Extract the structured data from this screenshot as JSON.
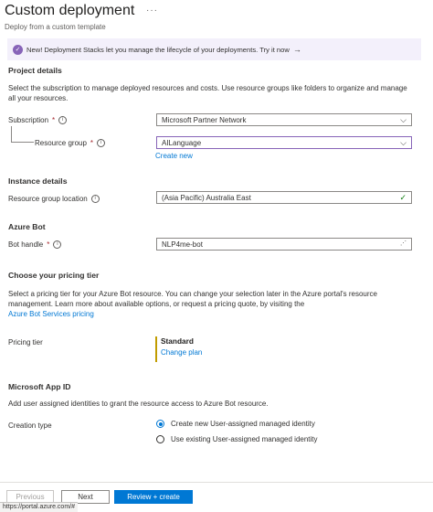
{
  "page": {
    "title": "Custom deployment",
    "more": "···",
    "subtitle": "Deploy from a custom template"
  },
  "banner": {
    "icon": "rocket-badge-icon",
    "text": "New! Deployment Stacks let you manage the lifecycle of your deployments. Try it now",
    "arrow": "→"
  },
  "project": {
    "heading": "Project details",
    "description": "Select the subscription to manage deployed resources and costs. Use resource groups like folders to organize and manage all your resources.",
    "subscription_label": "Subscription",
    "subscription_value": "Microsoft Partner Network",
    "resource_group_label": "Resource group",
    "resource_group_value": "AILanguage",
    "create_new": "Create new"
  },
  "instance": {
    "heading": "Instance details",
    "location_label": "Resource group location",
    "location_value": "(Asia Pacific) Australia East"
  },
  "bot": {
    "heading": "Azure Bot",
    "handle_label": "Bot handle",
    "handle_value": "NLP4me-bot"
  },
  "pricing": {
    "heading": "Choose your pricing tier",
    "description": "Select a pricing tier for your Azure Bot resource. You can change your selection later in the Azure portal's resource management. Learn more about available options, or request a pricing quote, by visiting the",
    "link": "Azure Bot Services pricing",
    "tier_label": "Pricing tier",
    "tier_value": "Standard",
    "change_plan": "Change plan"
  },
  "appid": {
    "heading": "Microsoft App ID",
    "description": "Add user assigned identities to grant the resource access to Azure Bot resource.",
    "creation_label": "Creation type",
    "option_new": "Create new User-assigned managed identity",
    "option_existing": "Use existing User-assigned managed identity",
    "selected": "option_new"
  },
  "footer": {
    "previous": "Previous",
    "next": "Next",
    "review": "Review + create"
  },
  "statusbar": {
    "url": "https://portal.azure.com/#"
  },
  "common": {
    "required_mark": "*",
    "info_glyph": "i",
    "chevron": "⌵",
    "check": "✓"
  },
  "colors": {
    "accent": "#0078d4",
    "banner_bg": "#f3f0fb",
    "banner_icon": "#8764b8",
    "required": "#a4262c",
    "success": "#107c10"
  }
}
